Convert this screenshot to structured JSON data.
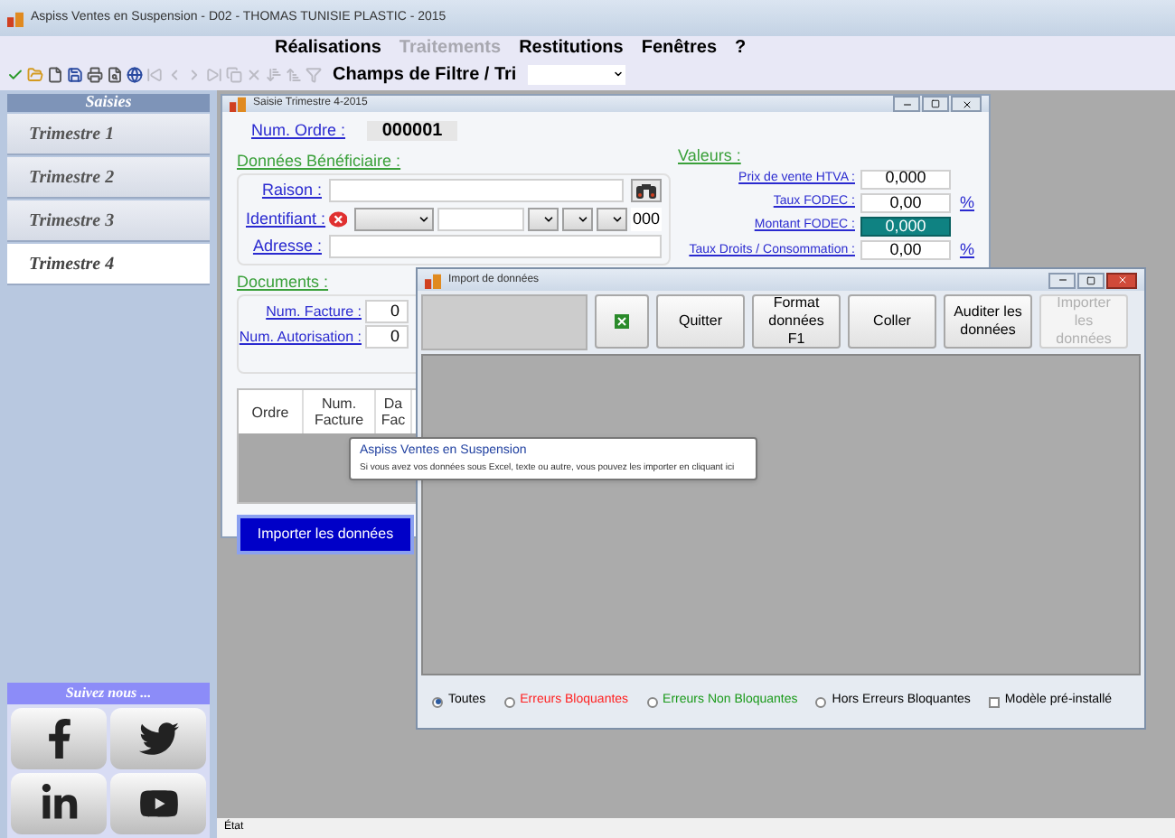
{
  "window": {
    "title": "Aspiss Ventes en Suspension - D02 - THOMAS TUNISIE PLASTIC - 2015"
  },
  "menu": [
    {
      "label": "Réalisations",
      "disabled": false
    },
    {
      "label": "Traitements",
      "disabled": true
    },
    {
      "label": "Restitutions",
      "disabled": false
    },
    {
      "label": "Fenêtres",
      "disabled": false
    },
    {
      "label": "?",
      "disabled": false
    }
  ],
  "toolbar": {
    "tools": [
      {
        "kind": "validate",
        "disabled": false
      },
      {
        "kind": "open",
        "disabled": false
      },
      {
        "kind": "new",
        "disabled": false
      },
      {
        "kind": "save",
        "disabled": false
      },
      {
        "kind": "print",
        "disabled": false
      },
      {
        "kind": "preview",
        "disabled": false
      },
      {
        "kind": "web",
        "disabled": false
      },
      {
        "kind": "first",
        "disabled": true
      },
      {
        "kind": "previous",
        "disabled": true
      },
      {
        "kind": "next",
        "disabled": true
      },
      {
        "kind": "last",
        "disabled": true
      },
      {
        "kind": "copy",
        "disabled": true
      },
      {
        "kind": "delete",
        "disabled": true
      },
      {
        "kind": "sort_down",
        "disabled": true
      },
      {
        "kind": "sort_up",
        "disabled": true
      },
      {
        "kind": "filter",
        "disabled": true
      }
    ],
    "filter_label": "Champs de Filtre / Tri"
  },
  "sidebar": {
    "header": "Saisies",
    "items": [
      {
        "label": "Trimestre 1",
        "selected": false
      },
      {
        "label": "Trimestre 2",
        "selected": false
      },
      {
        "label": "Trimestre 3",
        "selected": false
      },
      {
        "label": "Trimestre 4",
        "selected": true
      }
    ],
    "follow_label": "Suivez nous ...",
    "social": [
      {
        "kind": "facebook"
      },
      {
        "kind": "twitter"
      },
      {
        "kind": "linkedin"
      },
      {
        "kind": "youtube"
      }
    ]
  },
  "saisie_window": {
    "title": "Saisie Trimestre 4-2015",
    "order_label": "Num. Ordre :",
    "order_value": "000001",
    "beneficiary_title": "Données Bénéficiaire :",
    "raison_label": "Raison :",
    "identifiant_label": "Identifiant :",
    "identifiant_suffix": "000",
    "adresse_label": "Adresse :",
    "documents_title": "Documents :",
    "documents": [
      {
        "label": "Num. Facture :",
        "value": "0"
      },
      {
        "label": "Num. Autorisation :",
        "value": "0"
      }
    ],
    "table_columns": [
      "Ordre",
      "Num. Facture",
      "Da Fac"
    ],
    "values_title": "Valeurs :",
    "values": [
      {
        "label": "Prix de vente HTVA :",
        "value": "0,000",
        "highlighted": false
      },
      {
        "label": "Taux FODEC :",
        "value": "0,00",
        "unit": "%",
        "highlighted": false
      },
      {
        "label": "Montant FODEC :",
        "value": "0,000",
        "highlighted": true
      },
      {
        "label": "Taux Droits / Consommation :",
        "value": "0,00",
        "unit": "%",
        "highlighted": false
      }
    ],
    "import_button": "Importer les données"
  },
  "tooltip": {
    "title": "Aspiss Ventes en Suspension",
    "text": "Si vous avez vos données sous Excel, texte ou autre, vous pouvez les importer en cliquant ici"
  },
  "import_window": {
    "title": "Import de données",
    "buttons": [
      {
        "kind": "excel",
        "disabled": false
      },
      {
        "kind": "text",
        "label": "Quitter",
        "disabled": false
      },
      {
        "kind": "text",
        "label": "Format données F1",
        "disabled": false
      },
      {
        "kind": "text",
        "label": "Coller",
        "disabled": false
      },
      {
        "kind": "text",
        "label": "Auditer les données",
        "disabled": false
      },
      {
        "kind": "text",
        "label": "Importer les données",
        "disabled": true
      }
    ],
    "filters": [
      {
        "label": "Toutes",
        "selected": true,
        "color": "#000000"
      },
      {
        "label": "Erreurs Bloquantes",
        "selected": false,
        "color": "#ff2020"
      },
      {
        "label": "Erreurs Non Bloquantes",
        "selected": false,
        "color": "#1a9a1a"
      },
      {
        "label": "Hors Erreurs Bloquantes",
        "selected": false,
        "color": "#000000"
      }
    ],
    "preset": {
      "label": "Modèle pré-installé",
      "checked": false
    }
  },
  "status_bar": {
    "text": "État"
  }
}
